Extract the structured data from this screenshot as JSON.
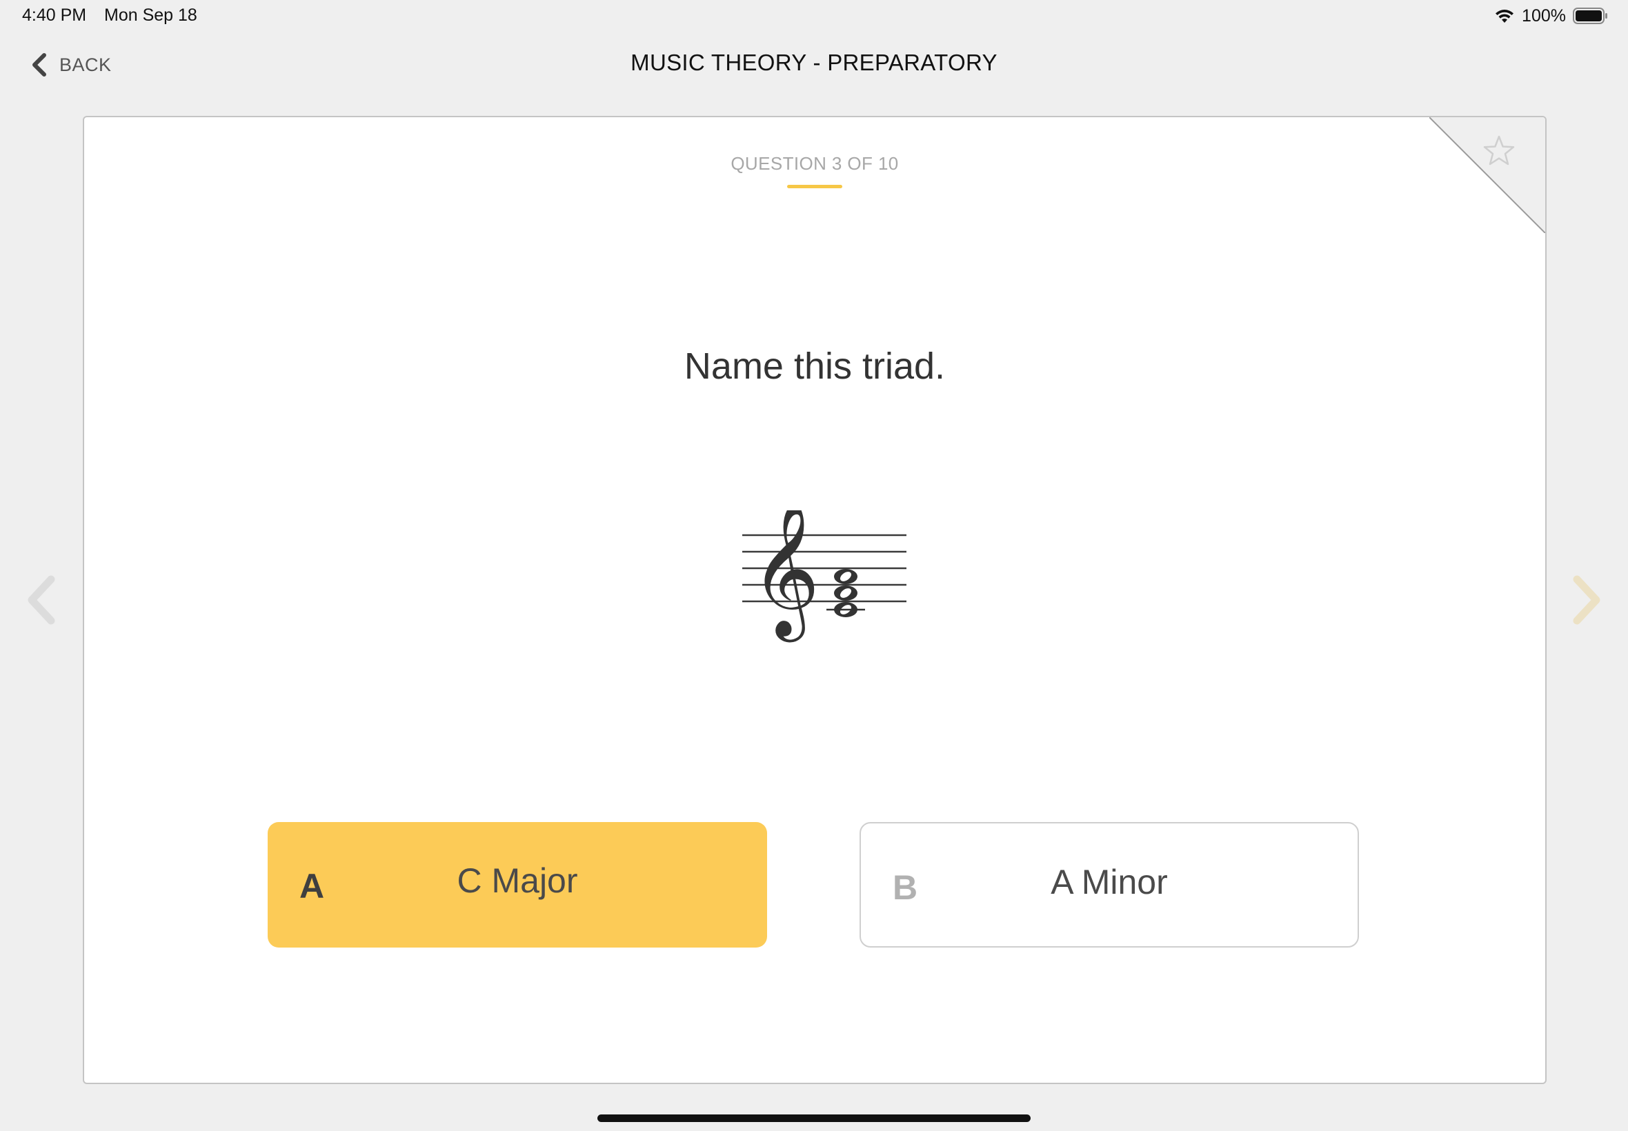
{
  "status_bar": {
    "time": "4:40 PM",
    "date": "Mon Sep 18",
    "battery": "100%"
  },
  "header": {
    "back_label": "BACK",
    "title": "MUSIC THEORY - PREPARATORY"
  },
  "card": {
    "question_counter": "QUESTION 3 OF 10",
    "question_text": "Name this triad.",
    "answers": [
      {
        "letter": "A",
        "label": "C Major",
        "selected": true
      },
      {
        "letter": "B",
        "label": "A Minor",
        "selected": false
      }
    ]
  },
  "icons": {
    "back": "chevron-left-icon",
    "prev": "chevron-left-icon",
    "next": "chevron-right-icon",
    "favorite": "star-outline-icon",
    "clef": "treble-clef-icon"
  },
  "colors": {
    "accent": "#fccb57",
    "counter_underline": "#f6c746",
    "background": "#efefef"
  }
}
